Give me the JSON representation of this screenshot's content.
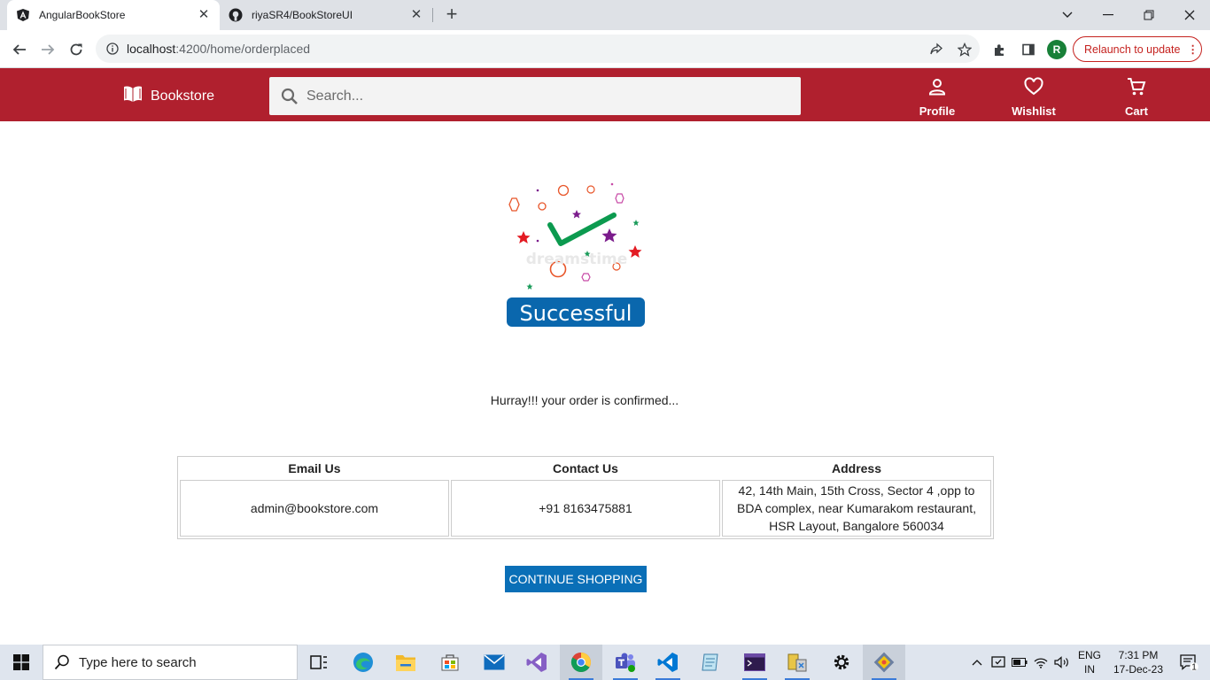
{
  "browser": {
    "tabs": [
      {
        "title": "AngularBookStore",
        "active": true,
        "favicon": "angular-icon"
      },
      {
        "title": "riyaSR4/BookStoreUI",
        "active": false,
        "favicon": "github-icon"
      }
    ],
    "url_host": "localhost",
    "url_path": ":4200/home/orderplaced",
    "profile_initial": "R",
    "relaunch_label": "Relaunch to update",
    "relaunch_menu": "⋮"
  },
  "header": {
    "brand": "Bookstore",
    "search_placeholder": "Search...",
    "profile_label": "Profile",
    "wishlist_label": "Wishlist",
    "cart_label": "Cart",
    "brand_color": "#b0202e"
  },
  "success": {
    "badge_text": "Successful",
    "watermark": "dreamstime"
  },
  "main": {
    "confirm_message": "Hurray!!! your order is confirmed...",
    "contact_table": {
      "headers": [
        "Email Us",
        "Contact Us",
        "Address"
      ],
      "email": "admin@bookstore.com",
      "phone": "+91 8163475881",
      "address": "42, 14th Main, 15th Cross, Sector 4 ,opp to BDA complex, near Kumarakom restaurant, HSR Layout, Bangalore 560034"
    },
    "continue_label": "CONTINUE SHOPPING",
    "button_color": "#0a6fb7"
  },
  "taskbar": {
    "search_placeholder": "Type here to search",
    "language_line1": "ENG",
    "language_line2": "IN",
    "time": "7:31 PM",
    "date": "17-Dec-23",
    "notification_count": "1",
    "apps": [
      "task-view-icon",
      "edge-icon",
      "file-explorer-icon",
      "store-icon",
      "mail-icon",
      "visual-studio-icon",
      "chrome-icon",
      "teams-icon",
      "vscode-icon",
      "notepad-icon",
      "terminal-icon",
      "db-tool-icon",
      "settings-icon",
      "git-icon"
    ]
  }
}
